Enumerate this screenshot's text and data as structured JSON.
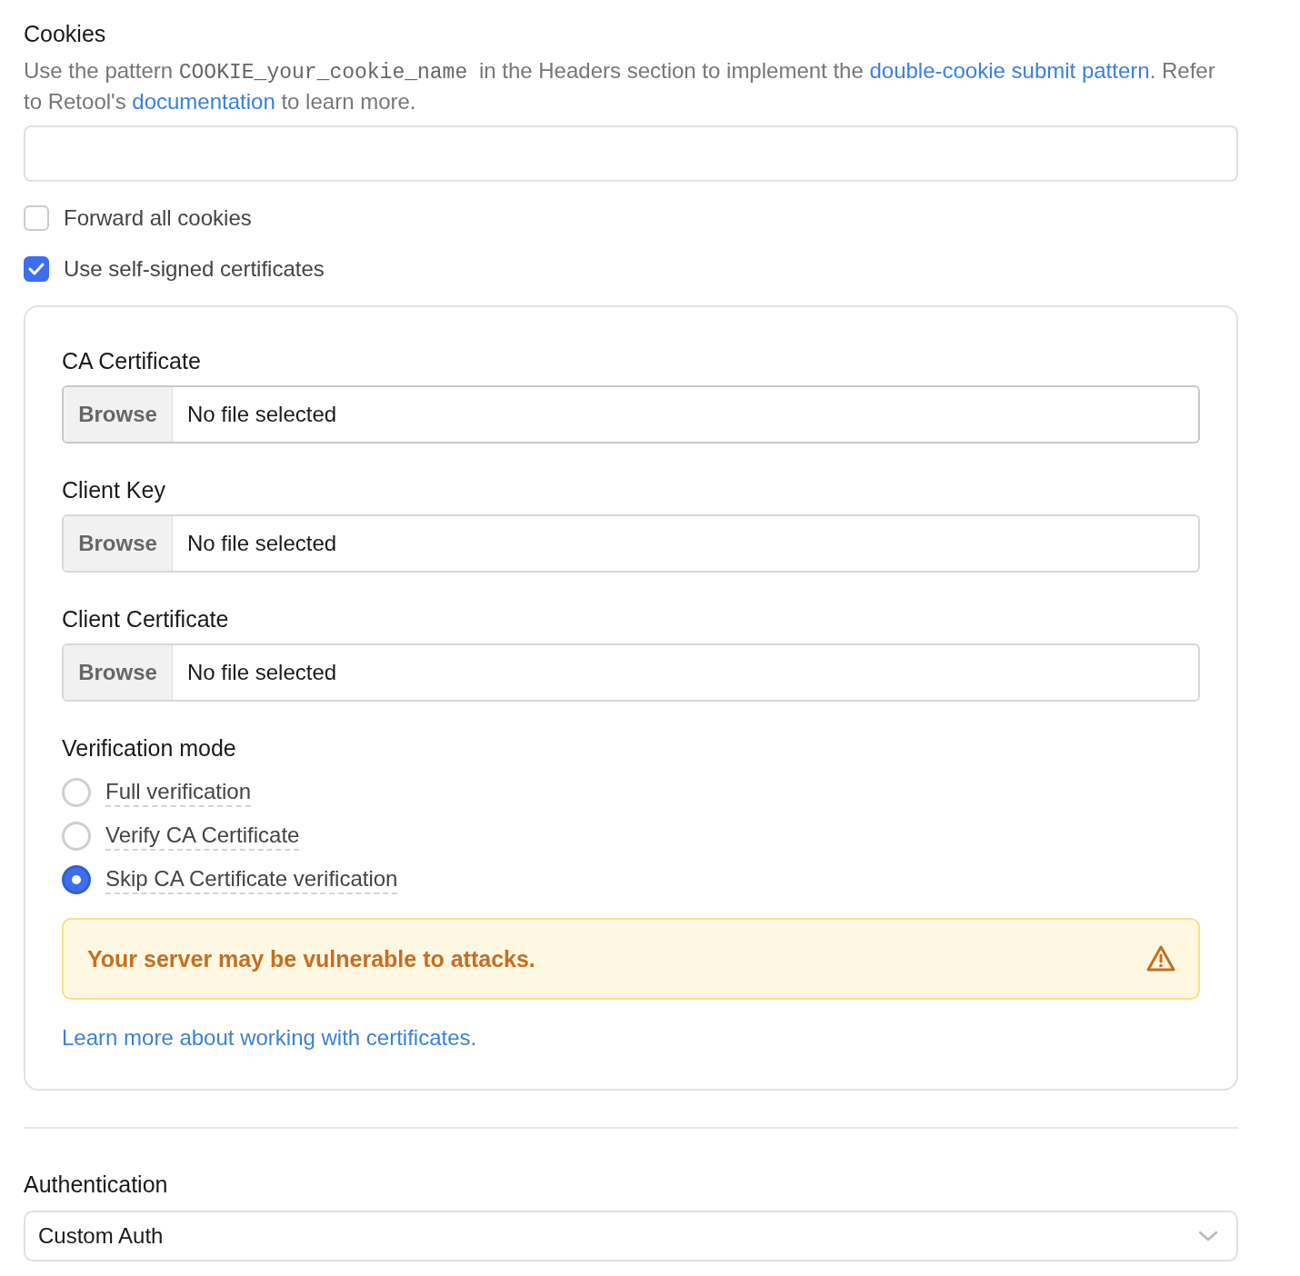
{
  "cookies": {
    "title": "Cookies",
    "description": [
      {
        "kind": "text",
        "text": "Use the pattern "
      },
      {
        "kind": "code",
        "text": "COOKIE_your_cookie_name"
      },
      {
        "kind": "text",
        "text": " in the Headers section to implement the "
      },
      {
        "kind": "link",
        "text": "double-cookie submit pattern"
      },
      {
        "kind": "text",
        "text": ". Refer to Retool's "
      },
      {
        "kind": "link",
        "text": "documentation"
      },
      {
        "kind": "text",
        "text": " to learn more."
      }
    ],
    "checkboxes": [
      {
        "label": "Forward all cookies",
        "checked": false
      },
      {
        "label": "Use self-signed certificates",
        "checked": true
      }
    ]
  },
  "certificates": {
    "files": [
      {
        "label": "CA Certificate",
        "button": "Browse",
        "value": "No file selected"
      },
      {
        "label": "Client Key",
        "button": "Browse",
        "value": "No file selected"
      },
      {
        "label": "Client Certificate",
        "button": "Browse",
        "value": "No file selected"
      }
    ],
    "verification_mode": {
      "label": "Verification mode",
      "options": [
        {
          "label": "Full verification",
          "selected": false
        },
        {
          "label": "Verify CA Certificate",
          "selected": false
        },
        {
          "label": "Skip CA Certificate verification",
          "selected": true
        }
      ]
    },
    "warning": "Your server may be vulnerable to attacks.",
    "learn_more": "Learn more about working with certificates."
  },
  "authentication": {
    "title": "Authentication",
    "value": "Custom Auth"
  }
}
